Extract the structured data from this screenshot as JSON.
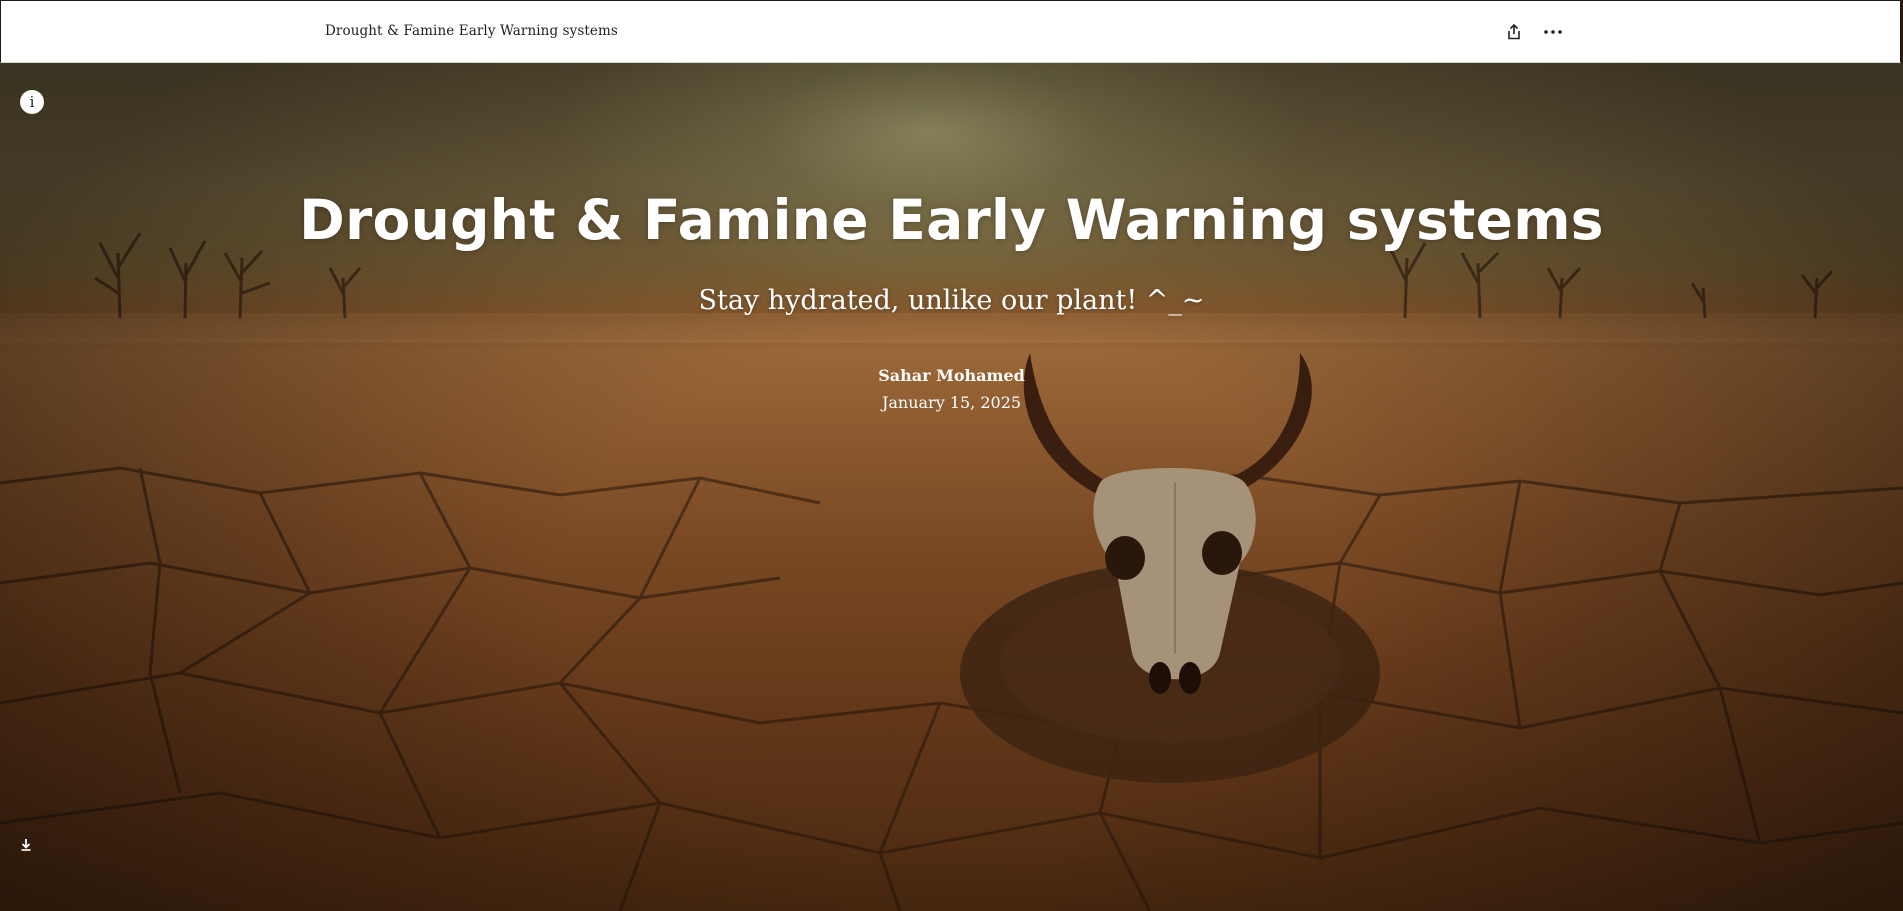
{
  "header": {
    "title": "Drought & Famine Early Warning systems",
    "share_icon": "share-icon",
    "more_icon": "more-options-icon"
  },
  "hero": {
    "image": "cracked-earth-skull-image",
    "info_icon": "info-icon",
    "info_glyph": "i",
    "title": "Drought & Famine Early Warning systems",
    "subtitle": "Stay hydrated, unlike our plant! ^_~",
    "author": "Sahar Mohamed",
    "date": "January 15, 2025",
    "scroll_icon": "arrow-down-icon"
  },
  "colors": {
    "text_on_image": "#ffffff",
    "header_bg": "#ffffff",
    "header_text": "#1e1e1e"
  }
}
